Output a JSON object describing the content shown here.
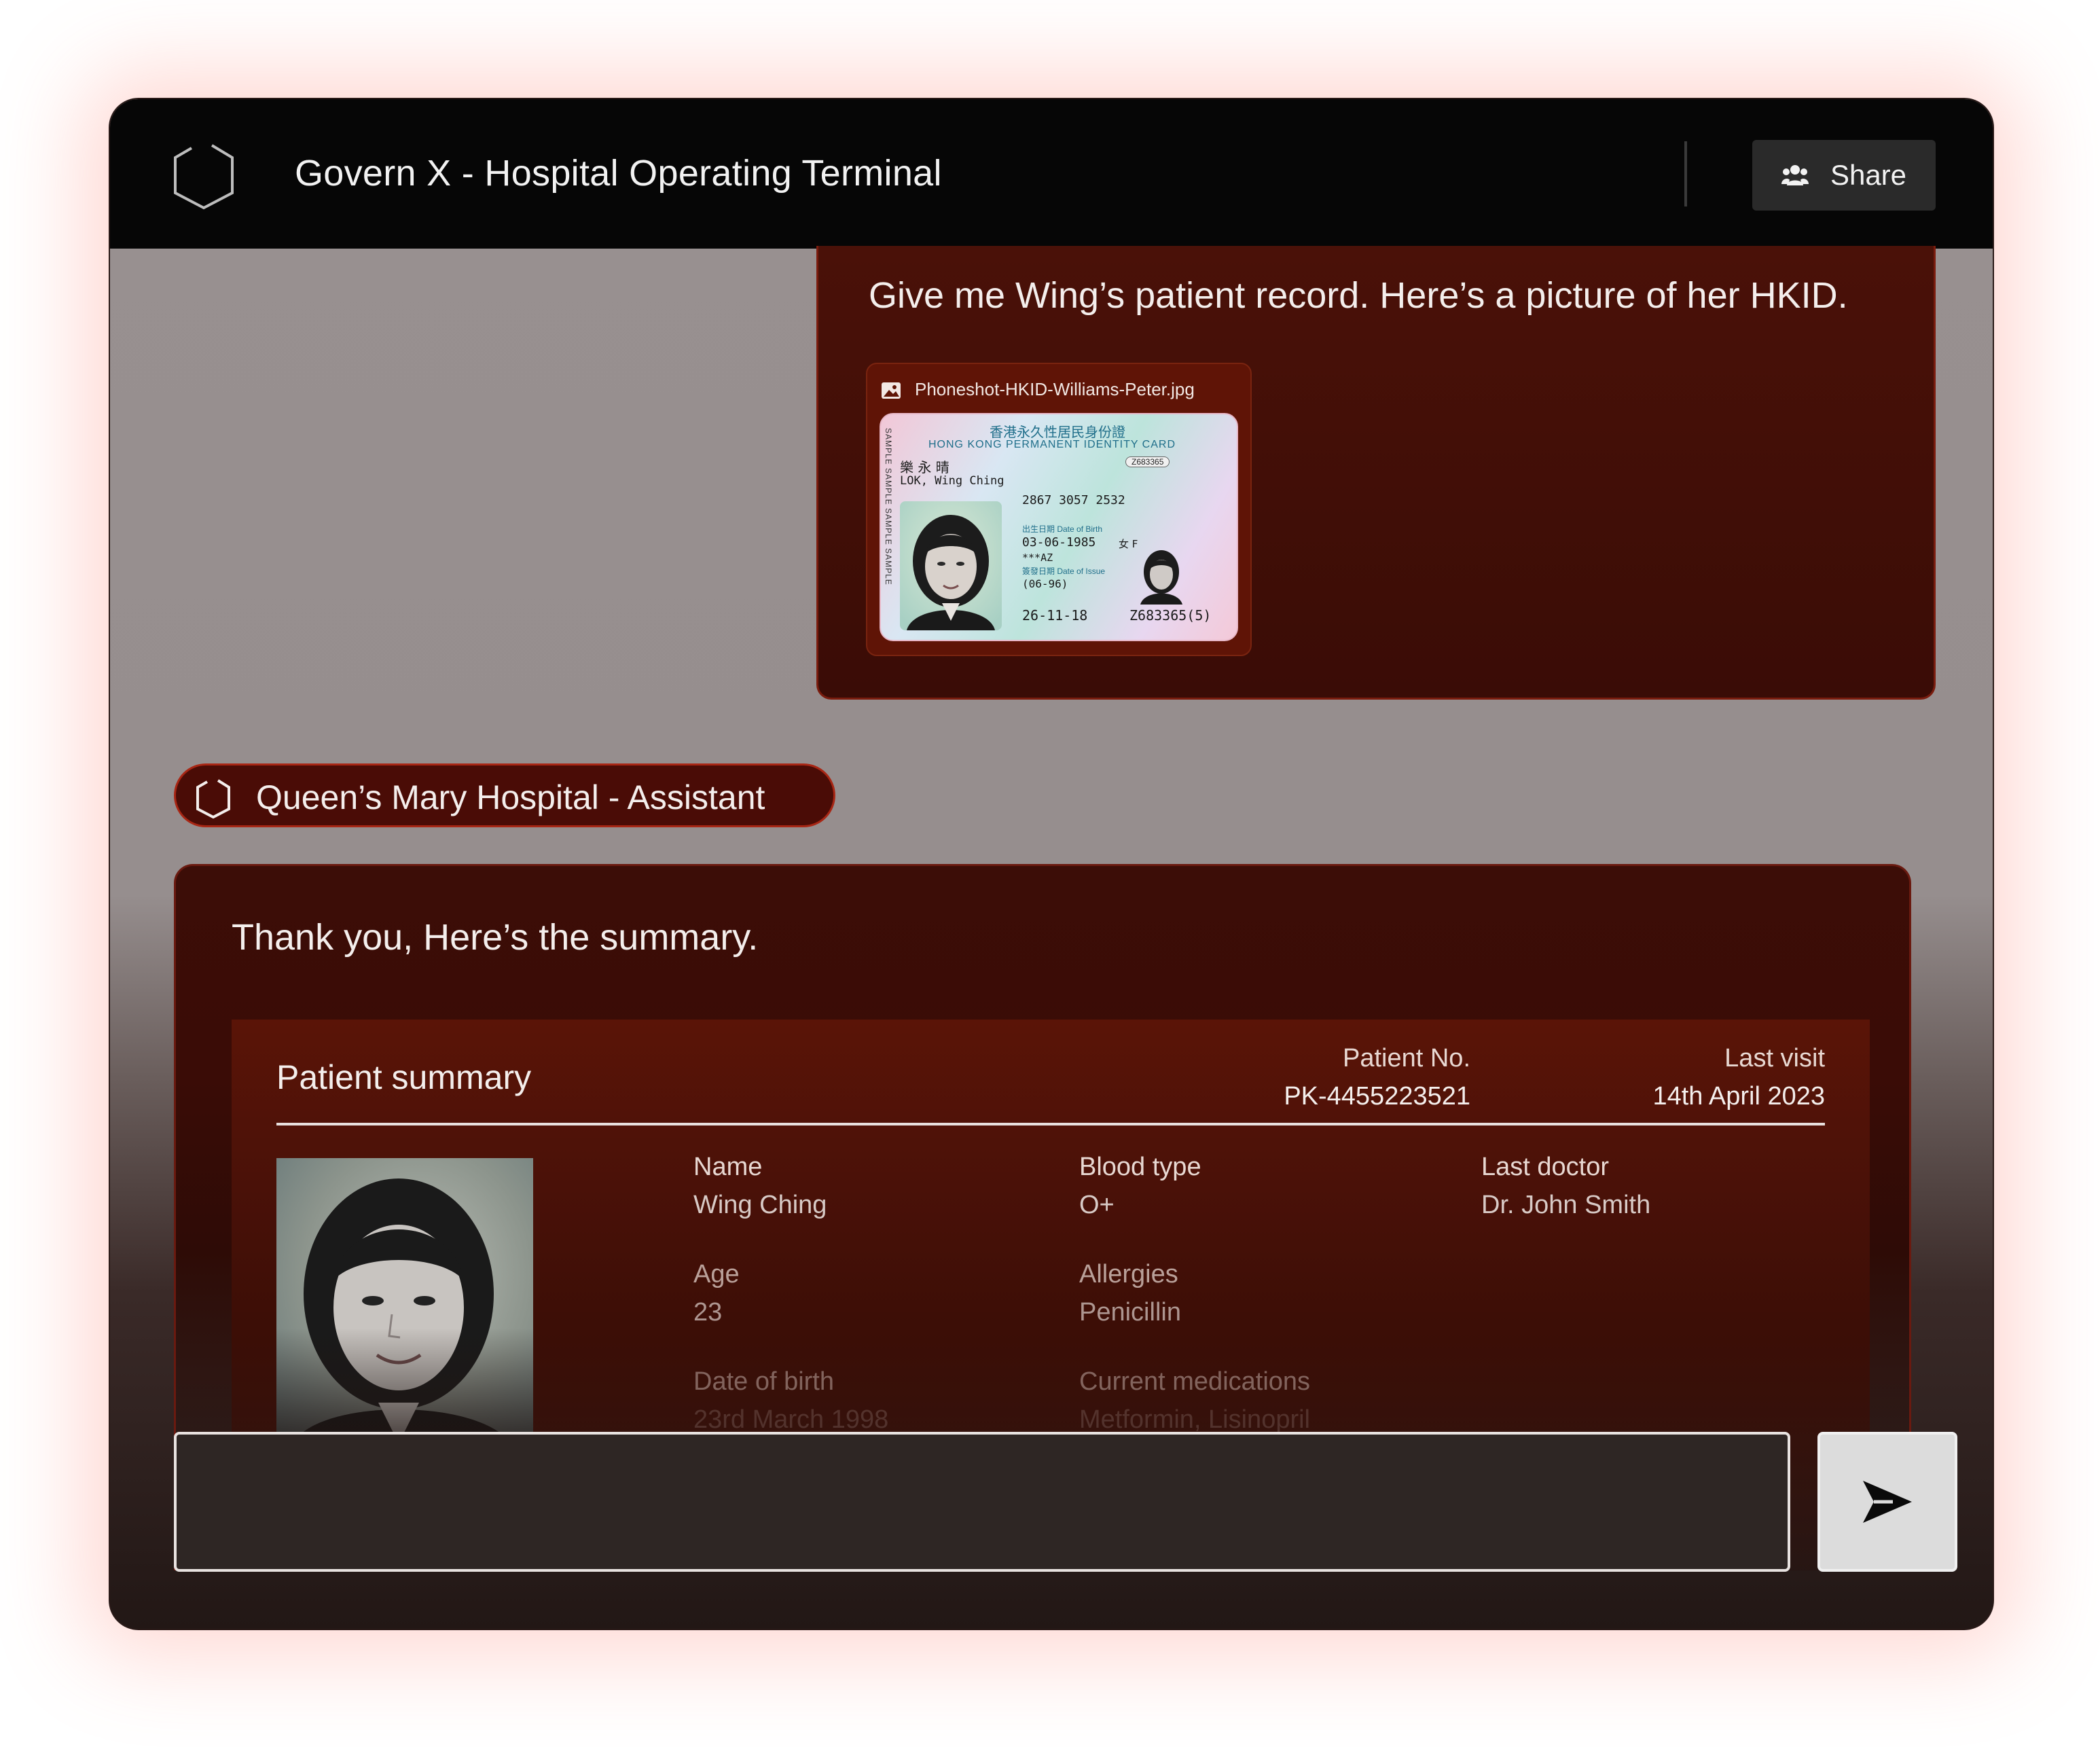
{
  "app": {
    "title": "Govern X - Hospital Operating Terminal",
    "share_label": "Share"
  },
  "user_message": {
    "text": "Give me Wing’s patient record. Here’s a picture of her HKID.",
    "attachment": {
      "filename": "Phoneshot-HKID-Williams-Peter.jpg",
      "card": {
        "title_cn": "香港永久性居民身份證",
        "title_en": "HONG KONG PERMANENT IDENTITY CARD",
        "serial": "Z683365",
        "name_cn": "樂 永 晴",
        "name_en": "LOK, Wing Ching",
        "ccc": "2867 3057 2532",
        "dob_label": "出生日期 Date of Birth",
        "dob": "03-06-1985",
        "sex": "女 F",
        "symbols": "***AZ",
        "issue_label": "簽發日期 Date of Issue",
        "issue_prev": "(06-96)",
        "issue_date": "26-11-18",
        "id_number": "Z683365(5)",
        "side_text": "SAMPLE SAMPLE SAMPLE SAMPLE"
      }
    }
  },
  "assistant": {
    "name": "Queen’s Mary Hospital - Assistant",
    "reply": "Thank you, Here’s the summary."
  },
  "summary": {
    "title": "Patient summary",
    "patient_no_label": "Patient No.",
    "patient_no": "PK-4455223521",
    "last_visit_label": "Last visit",
    "last_visit": "14th April 2023",
    "fields": {
      "name_label": "Name",
      "name": "Wing Ching",
      "blood_label": "Blood type",
      "blood": "O+",
      "doctor_label": "Last doctor",
      "doctor": "Dr. John Smith",
      "age_label": "Age",
      "age": "23",
      "allergies_label": "Allergies",
      "allergies": "Penicillin",
      "dob_label": "Date of birth",
      "dob": "23rd March 1998",
      "meds_label": "Current medications",
      "meds": "Metformin, Lisinopril"
    }
  },
  "composer": {
    "placeholder": "",
    "send_icon": "send-icon"
  },
  "colors": {
    "accent": "#a82614",
    "card_bg": "#3a0c06",
    "topbar": "#060606"
  }
}
